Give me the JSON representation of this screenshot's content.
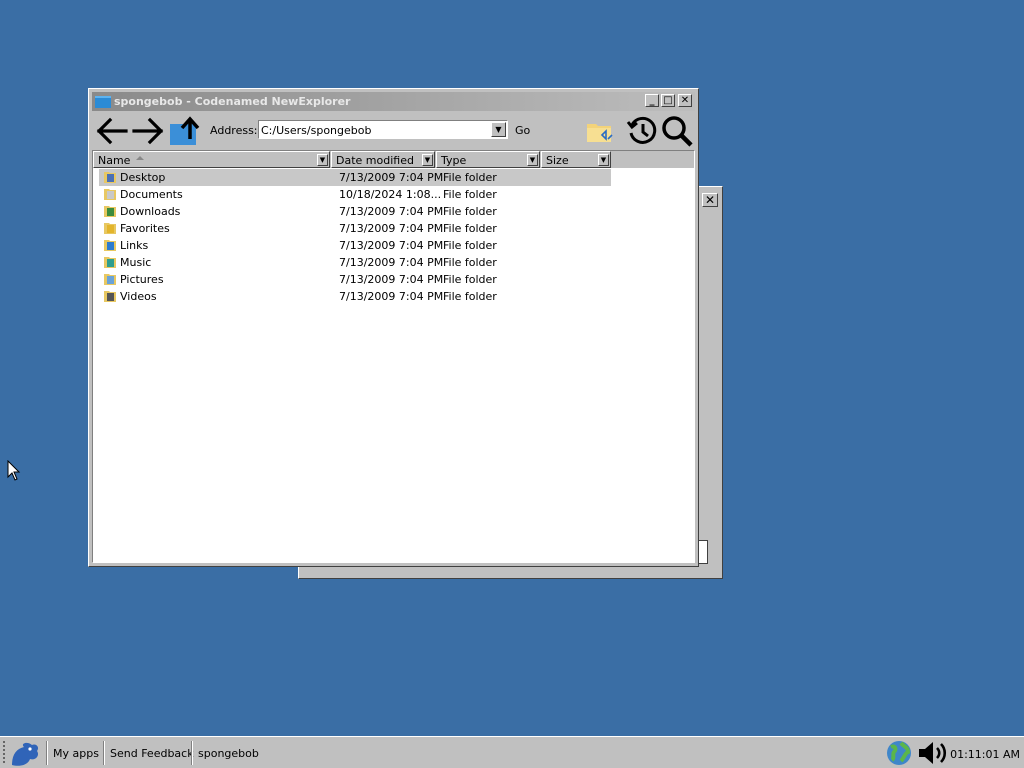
{
  "background_window": {
    "close_glyph": "✕"
  },
  "window": {
    "title": "spongebob - Codenamed NewExplorer",
    "buttons": {
      "minimize": "_",
      "maximize": "□",
      "close": "✕"
    }
  },
  "toolbar": {
    "back_icon": "back-arrow-icon",
    "forward_icon": "forward-arrow-icon",
    "up_icon": "up-folder-icon",
    "address_label": "Address:",
    "address_value": "C:/Users/spongebob",
    "go_label": "Go",
    "sync_icon": "folder-sync-icon",
    "history_icon": "history-icon",
    "search_icon": "search-icon"
  },
  "columns": [
    {
      "label": "Name"
    },
    {
      "label": "Date modified"
    },
    {
      "label": "Type"
    },
    {
      "label": "Size"
    }
  ],
  "files": [
    {
      "name": "Desktop",
      "date": "7/13/2009 7:04 PM",
      "type": "File folder",
      "icon": "desktop-folder-icon",
      "selected": true
    },
    {
      "name": "Documents",
      "date": "10/18/2024 1:08...",
      "type": "File folder",
      "icon": "documents-folder-icon"
    },
    {
      "name": "Downloads",
      "date": "7/13/2009 7:04 PM",
      "type": "File folder",
      "icon": "downloads-folder-icon"
    },
    {
      "name": "Favorites",
      "date": "7/13/2009 7:04 PM",
      "type": "File folder",
      "icon": "favorites-folder-icon"
    },
    {
      "name": "Links",
      "date": "7/13/2009 7:04 PM",
      "type": "File folder",
      "icon": "links-folder-icon"
    },
    {
      "name": "Music",
      "date": "7/13/2009 7:04 PM",
      "type": "File folder",
      "icon": "music-folder-icon"
    },
    {
      "name": "Pictures",
      "date": "7/13/2009 7:04 PM",
      "type": "File folder",
      "icon": "pictures-folder-icon"
    },
    {
      "name": "Videos",
      "date": "7/13/2009 7:04 PM",
      "type": "File folder",
      "icon": "videos-folder-icon"
    }
  ],
  "taskbar": {
    "start_icon": "start-logo-icon",
    "my_apps": "My apps",
    "send_feedback": "Send Feedback",
    "task": "spongebob",
    "network_icon": "network-globe-icon",
    "volume_icon": "volume-icon",
    "clock": "01:11:01 AM"
  },
  "colors": {
    "desktop": "#3a6ea5",
    "chrome": "#c0c0c0",
    "selection": "#c8c8c8"
  }
}
